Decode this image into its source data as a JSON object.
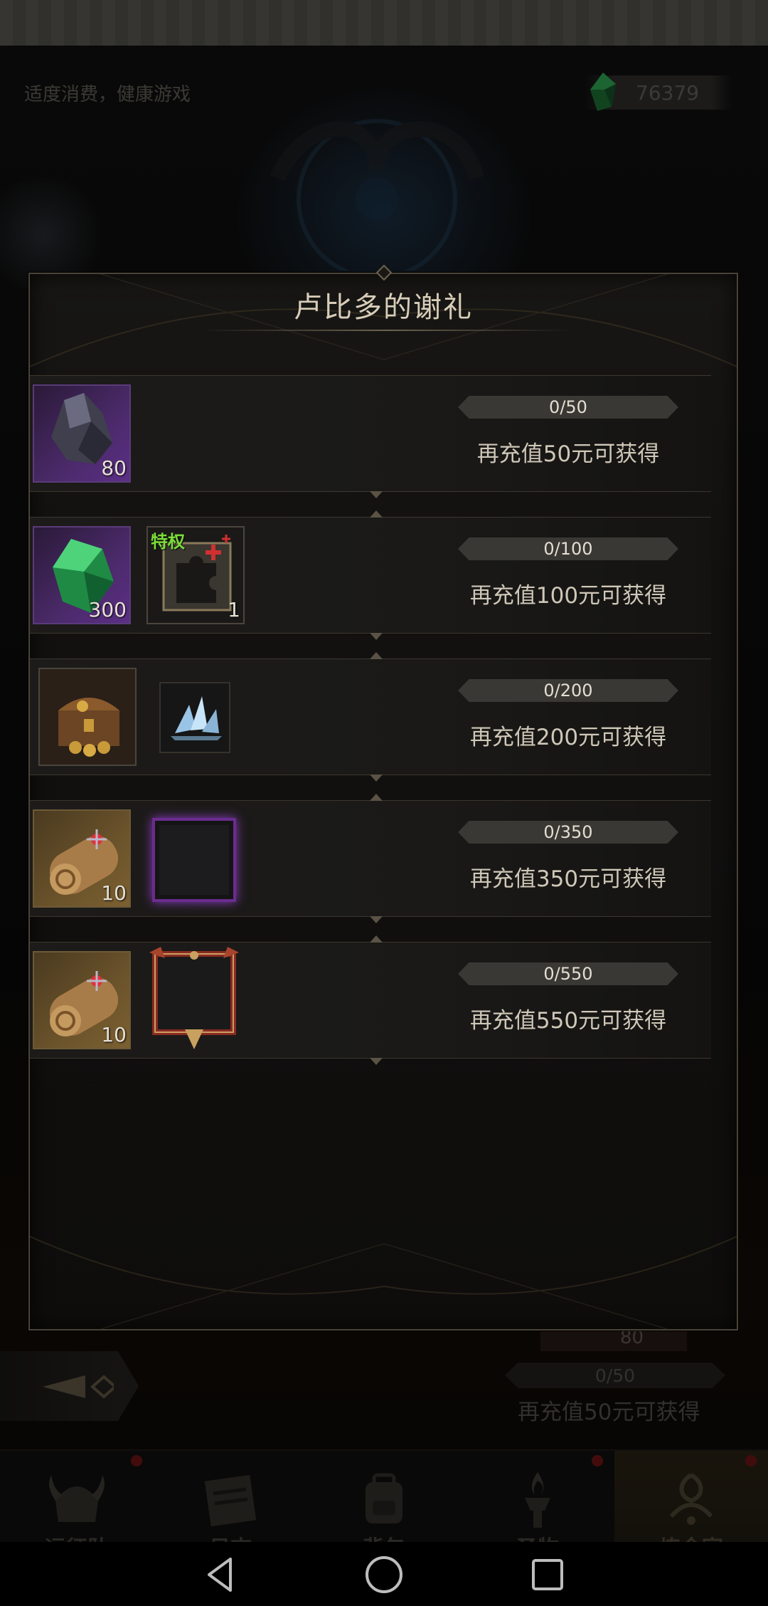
{
  "header": {
    "notice": "适度消费，健康游戏",
    "currency_amount": "76379",
    "currency_icon": "green-gem-icon"
  },
  "dialog": {
    "title": "卢比多的谢礼",
    "tiers": [
      {
        "progress_text": "0/50",
        "progress": 0,
        "reward_text": "再充值50元可获得",
        "items": [
          {
            "icon": "dark-ore-icon",
            "qty": "80",
            "frame": "purple"
          }
        ]
      },
      {
        "progress_text": "0/100",
        "progress": 0,
        "reward_text": "再充值100元可获得",
        "items": [
          {
            "icon": "green-gem-icon",
            "qty": "300",
            "frame": "purple"
          },
          {
            "icon": "privilege-puzzle-icon",
            "qty": "1",
            "frame": "dark",
            "tag": "特权"
          }
        ]
      },
      {
        "progress_text": "0/200",
        "progress": 0,
        "reward_text": "再充值200元可获得",
        "items": [
          {
            "icon": "treasure-chest-icon",
            "qty": "",
            "frame": "dark"
          },
          {
            "icon": "ice-crystal-icon",
            "qty": "",
            "frame": "plain"
          }
        ]
      },
      {
        "progress_text": "0/350",
        "progress": 0,
        "reward_text": "再充值350元可获得",
        "items": [
          {
            "icon": "scroll-icon",
            "qty": "10",
            "frame": "gold"
          },
          {
            "icon": "purple-avatar-frame-icon",
            "qty": "",
            "frame": "plain"
          }
        ]
      },
      {
        "progress_text": "0/550",
        "progress": 0,
        "reward_text": "再充值550元可获得",
        "items": [
          {
            "icon": "scroll-icon",
            "qty": "10",
            "frame": "gold"
          },
          {
            "icon": "red-avatar-frame-icon",
            "qty": "",
            "frame": "plain"
          }
        ]
      }
    ]
  },
  "background": {
    "item_qty": "80",
    "progress_text": "0/50",
    "reward_text": "再充值50元可获得"
  },
  "bottom_nav": [
    {
      "label": "远征队",
      "icon": "viking-helmet-icon",
      "badge": true
    },
    {
      "label": "日志",
      "icon": "journal-icon",
      "badge": false
    },
    {
      "label": "背包",
      "icon": "backpack-icon",
      "badge": false
    },
    {
      "label": "圣物",
      "icon": "relic-torch-icon",
      "badge": true
    },
    {
      "label": "炼金室",
      "icon": "alchemy-icon",
      "badge": true,
      "active": true
    }
  ],
  "system_nav": [
    "back-icon",
    "home-icon",
    "recents-icon"
  ],
  "colors": {
    "dialog_border": "#4a4438",
    "text_main": "#cfc7b8",
    "tag_green": "#7bdc3a",
    "badge_red": "#7a1717",
    "purple_frame": "#4b2a6a",
    "gold_frame": "#6b532b"
  }
}
